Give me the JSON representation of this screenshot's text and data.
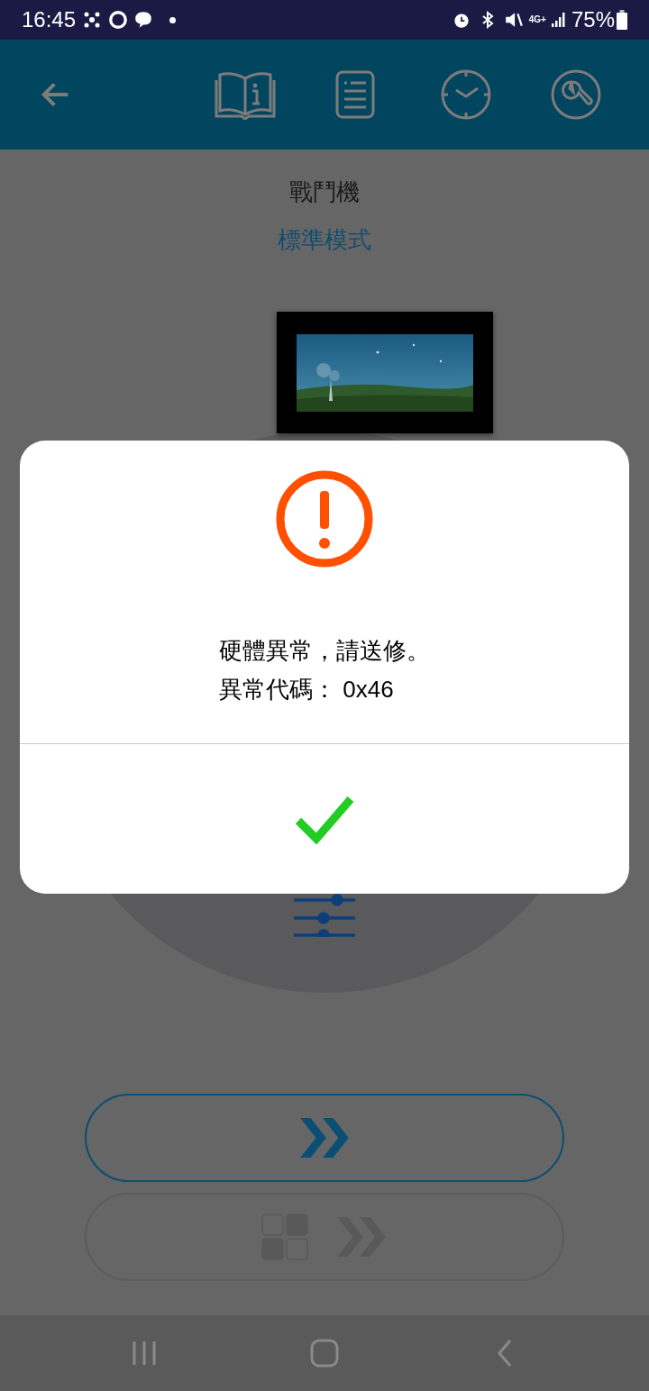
{
  "status_bar": {
    "time": "16:45",
    "battery": "75%",
    "network": "4G+"
  },
  "title": "戰鬥機",
  "mode": "標準模式",
  "dialog": {
    "lines": [
      "硬體異常，請送修。",
      "異常代碼： 0x46"
    ]
  }
}
